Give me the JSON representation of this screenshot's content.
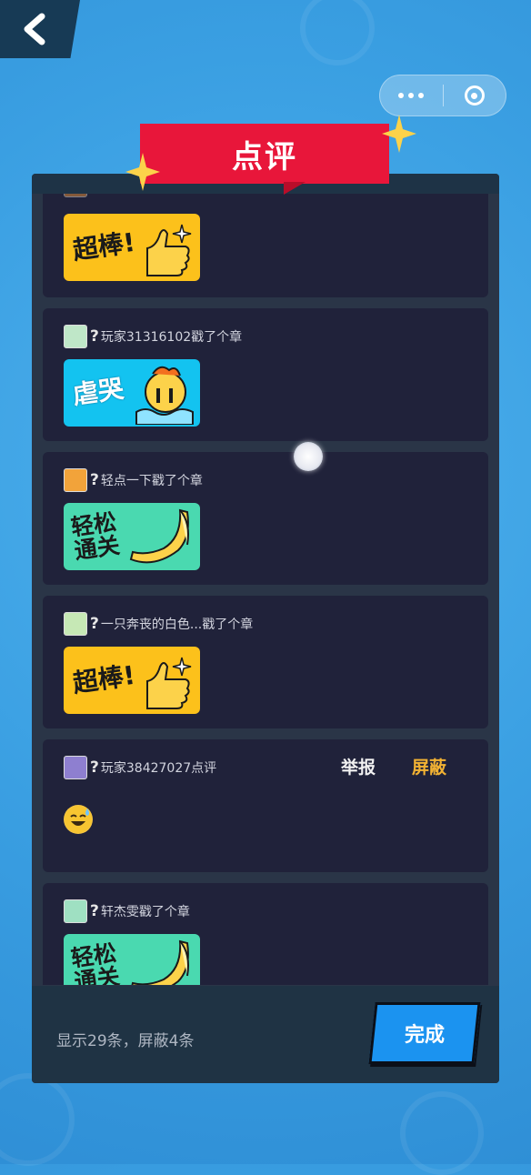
{
  "header": {
    "back_icon": "chevron-left-icon",
    "capsule_icons": [
      "more-dots-icon",
      "close-target-icon"
    ]
  },
  "banner": {
    "title": "点评"
  },
  "comments": [
    {
      "user": "",
      "action_text": "",
      "sticker": "超棒!",
      "sticker_style": "yellow",
      "avatar_color": "#e8913a"
    },
    {
      "user": "玩家31316102",
      "action_text": "戳了个章",
      "sticker": "虐哭",
      "sticker_style": "cyan",
      "avatar_color": "#bfe7c8"
    },
    {
      "user": "轻点一下",
      "action_text": "戳了个章",
      "sticker": "轻松通关",
      "sticker_style": "green",
      "avatar_color": "#f2a33a"
    },
    {
      "user": "一只奔丧的白色...",
      "action_text": "戳了个章",
      "sticker": "超棒!",
      "sticker_style": "yellow",
      "avatar_color": "#c6e8b5"
    },
    {
      "user": "玩家38427027",
      "action_text": "点评",
      "emoji": "😅",
      "report_label": "举报",
      "block_label": "屏蔽",
      "avatar_color": "#8e7fd0"
    },
    {
      "user": "轩杰雯",
      "action_text": "戳了个章",
      "sticker": "轻松通关",
      "sticker_style": "green",
      "avatar_color": "#9fe0c2"
    }
  ],
  "footer": {
    "summary": "显示29条，屏蔽4条",
    "done_label": "完成"
  },
  "colors": {
    "accent_red": "#e8163a",
    "done_blue": "#1b93f0",
    "block_gold": "#f2b233",
    "card_bg": "#20223a"
  }
}
